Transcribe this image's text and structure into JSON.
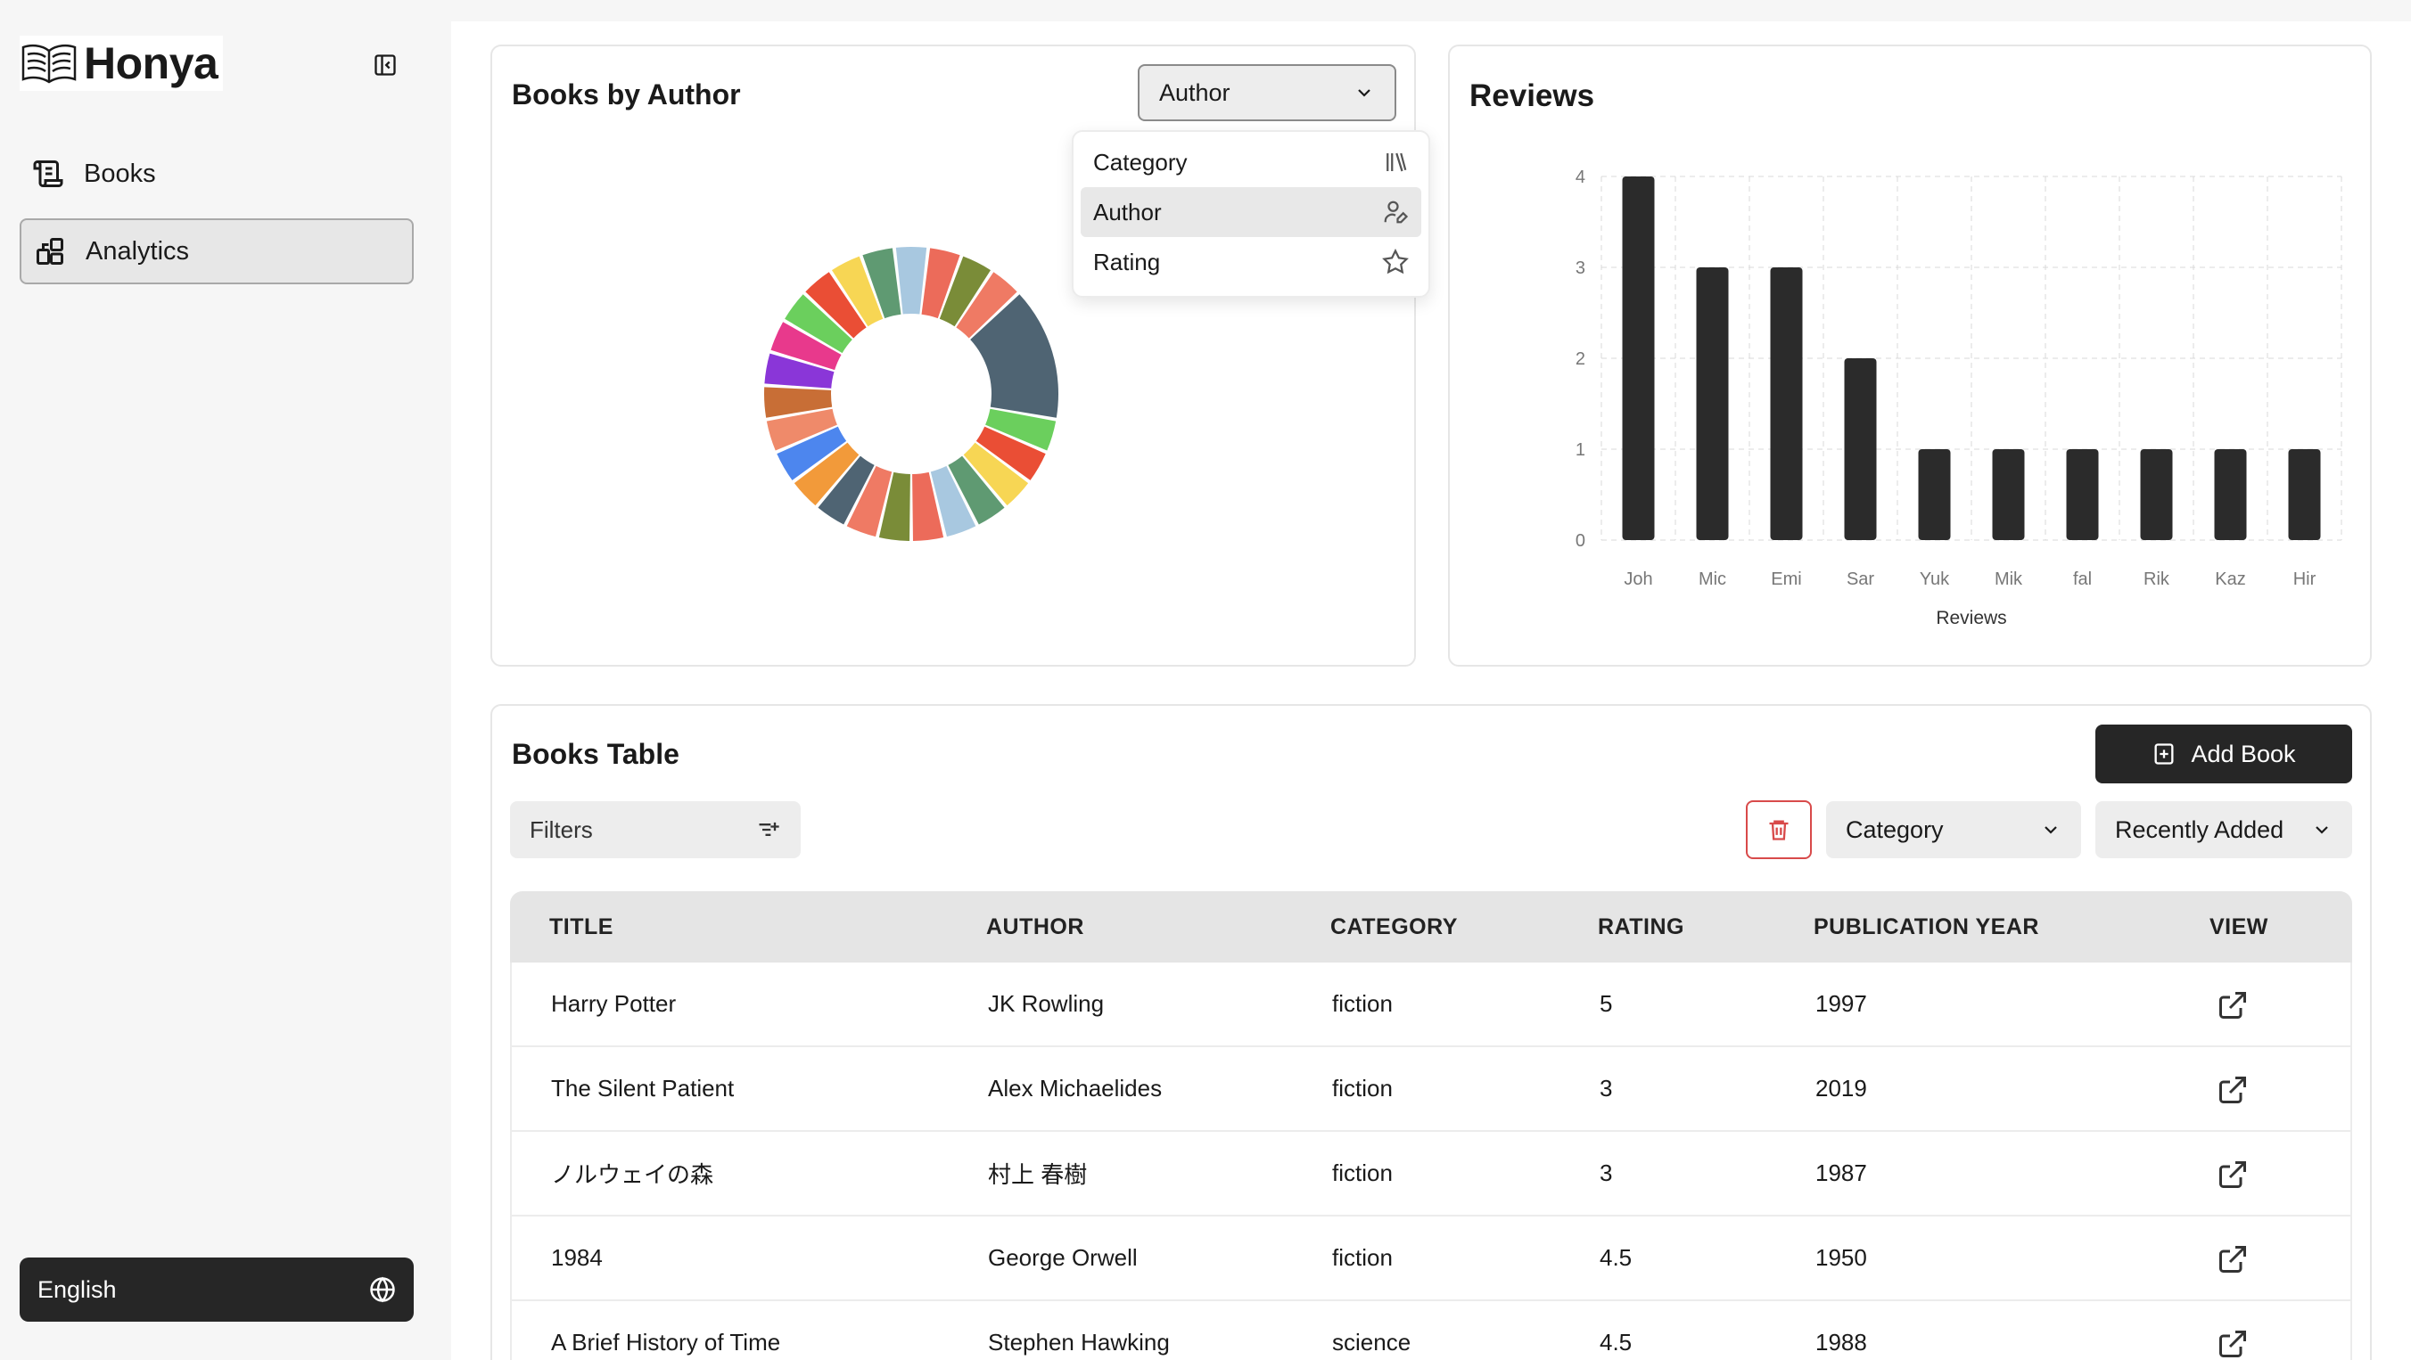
{
  "app": {
    "name": "Honya"
  },
  "sidebar": {
    "items": [
      {
        "label": "Books",
        "icon": "books-scroll-icon"
      },
      {
        "label": "Analytics",
        "icon": "analytics-icon",
        "active": true
      }
    ],
    "language": "English"
  },
  "donut_card": {
    "title": "Books by Author",
    "select_value": "Author",
    "dropdown_options": [
      {
        "label": "Category",
        "icon": "library-icon"
      },
      {
        "label": "Author",
        "icon": "user-pen-icon",
        "active": true
      },
      {
        "label": "Rating",
        "icon": "star-icon"
      }
    ]
  },
  "reviews_card": {
    "title": "Reviews"
  },
  "chart_data": [
    {
      "type": "pie",
      "variant": "donut",
      "slices": [
        {
          "value": 1,
          "color": "#a8c8e0"
        },
        {
          "value": 1,
          "color": "#ec6b5a"
        },
        {
          "value": 1,
          "color": "#7a8c38"
        },
        {
          "value": 1,
          "color": "#ef7a64"
        },
        {
          "value": 4,
          "color": "#4f6473"
        },
        {
          "value": 1,
          "color": "#6bcf5d"
        },
        {
          "value": 1,
          "color": "#ea4e35"
        },
        {
          "value": 1,
          "color": "#f7d654"
        },
        {
          "value": 1,
          "color": "#5f9a72"
        },
        {
          "value": 1,
          "color": "#a8c8e0"
        },
        {
          "value": 1,
          "color": "#ec6b5a"
        },
        {
          "value": 1,
          "color": "#7a8c38"
        },
        {
          "value": 1,
          "color": "#ef7a64"
        },
        {
          "value": 1,
          "color": "#4f6473"
        },
        {
          "value": 1,
          "color": "#f29a3a"
        },
        {
          "value": 1,
          "color": "#4d86ee"
        },
        {
          "value": 1,
          "color": "#ef8a6a"
        },
        {
          "value": 1,
          "color": "#c86e36"
        },
        {
          "value": 1,
          "color": "#8a36d8"
        },
        {
          "value": 1,
          "color": "#e8398c"
        },
        {
          "value": 1,
          "color": "#6bcf5d"
        },
        {
          "value": 1,
          "color": "#ea4e35"
        },
        {
          "value": 1,
          "color": "#f7d654"
        },
        {
          "value": 1,
          "color": "#5f9a72"
        }
      ]
    },
    {
      "type": "bar",
      "categories": [
        "Joh",
        "Mic",
        "Emi",
        "Sar",
        "Yuk",
        "Mik",
        "fal",
        "Rik",
        "Kaz",
        "Hir"
      ],
      "values": [
        4,
        3,
        3,
        2,
        1,
        1,
        1,
        1,
        1,
        1
      ],
      "xlabel": "Reviews",
      "ylabel": "",
      "ylim": [
        0,
        4
      ],
      "yticks": [
        "0",
        "1",
        "2",
        "3",
        "4"
      ],
      "grid": true,
      "bar_color": "#2b2b2b"
    }
  ],
  "table_card": {
    "title": "Books Table",
    "add_label": "Add Book",
    "filters_label": "Filters",
    "category_select": "Category",
    "sort_select": "Recently Added",
    "columns": [
      "TITLE",
      "AUTHOR",
      "CATEGORY",
      "RATING",
      "PUBLICATION YEAR",
      "VIEW"
    ],
    "rows": [
      [
        "Harry Potter",
        "JK Rowling",
        "fiction",
        "5",
        "1997"
      ],
      [
        "The Silent Patient",
        "Alex Michaelides",
        "fiction",
        "3",
        "2019"
      ],
      [
        "ノルウェイの森",
        "村上 春樹",
        "fiction",
        "3",
        "1987"
      ],
      [
        "1984",
        "George Orwell",
        "fiction",
        "4.5",
        "1950"
      ],
      [
        "A Brief History of Time",
        "Stephen Hawking",
        "science",
        "4.5",
        "1988"
      ]
    ]
  }
}
